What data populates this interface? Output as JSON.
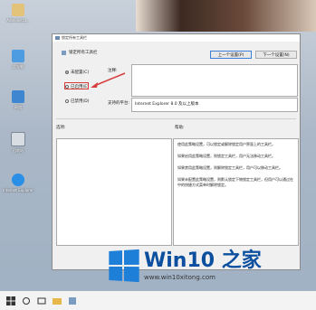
{
  "desktop": {
    "icons": [
      {
        "label": "Administra..."
      },
      {
        "label": "此电脑"
      },
      {
        "label": "网络"
      },
      {
        "label": "回收站"
      },
      {
        "label": "Internet Explorer"
      }
    ]
  },
  "dialog": {
    "title": "锁定所有工具栏",
    "heading": "锁定所有工具栏",
    "prev_button": "上一个设置(P)",
    "next_button": "下一个设置(N)",
    "radios": [
      {
        "label": "未配置(C)",
        "selected": true
      },
      {
        "label": "已启用(E)",
        "selected": false
      },
      {
        "label": "已禁用(D)",
        "selected": false
      }
    ],
    "comment_label": "注释:",
    "support_label": "支持的平台:",
    "support_value": "Internet Explorer 8.0 及以上版本",
    "options_label": "选项:",
    "help_label": "帮助:",
    "help_paragraphs": [
      "使用此策略设置，可以锁定或解除锁定用户界面上的工具栏。",
      "如果启用此策略设置，则锁定工具栏，用户无法移动工具栏。",
      "如果禁用此策略设置，则解除锁定工具栏，用户可以移动工具栏。",
      "如果未配置此策略设置，则默认锁定下物锁定工具栏，但用户可以通过在中的快捷方式菜单时解除锁定。"
    ]
  },
  "watermark": {
    "title": "Win10 之家",
    "url": "www.win10xitong.com"
  },
  "colors": {
    "accent": "#1e7fd8",
    "annotation": "#d83b3b"
  }
}
